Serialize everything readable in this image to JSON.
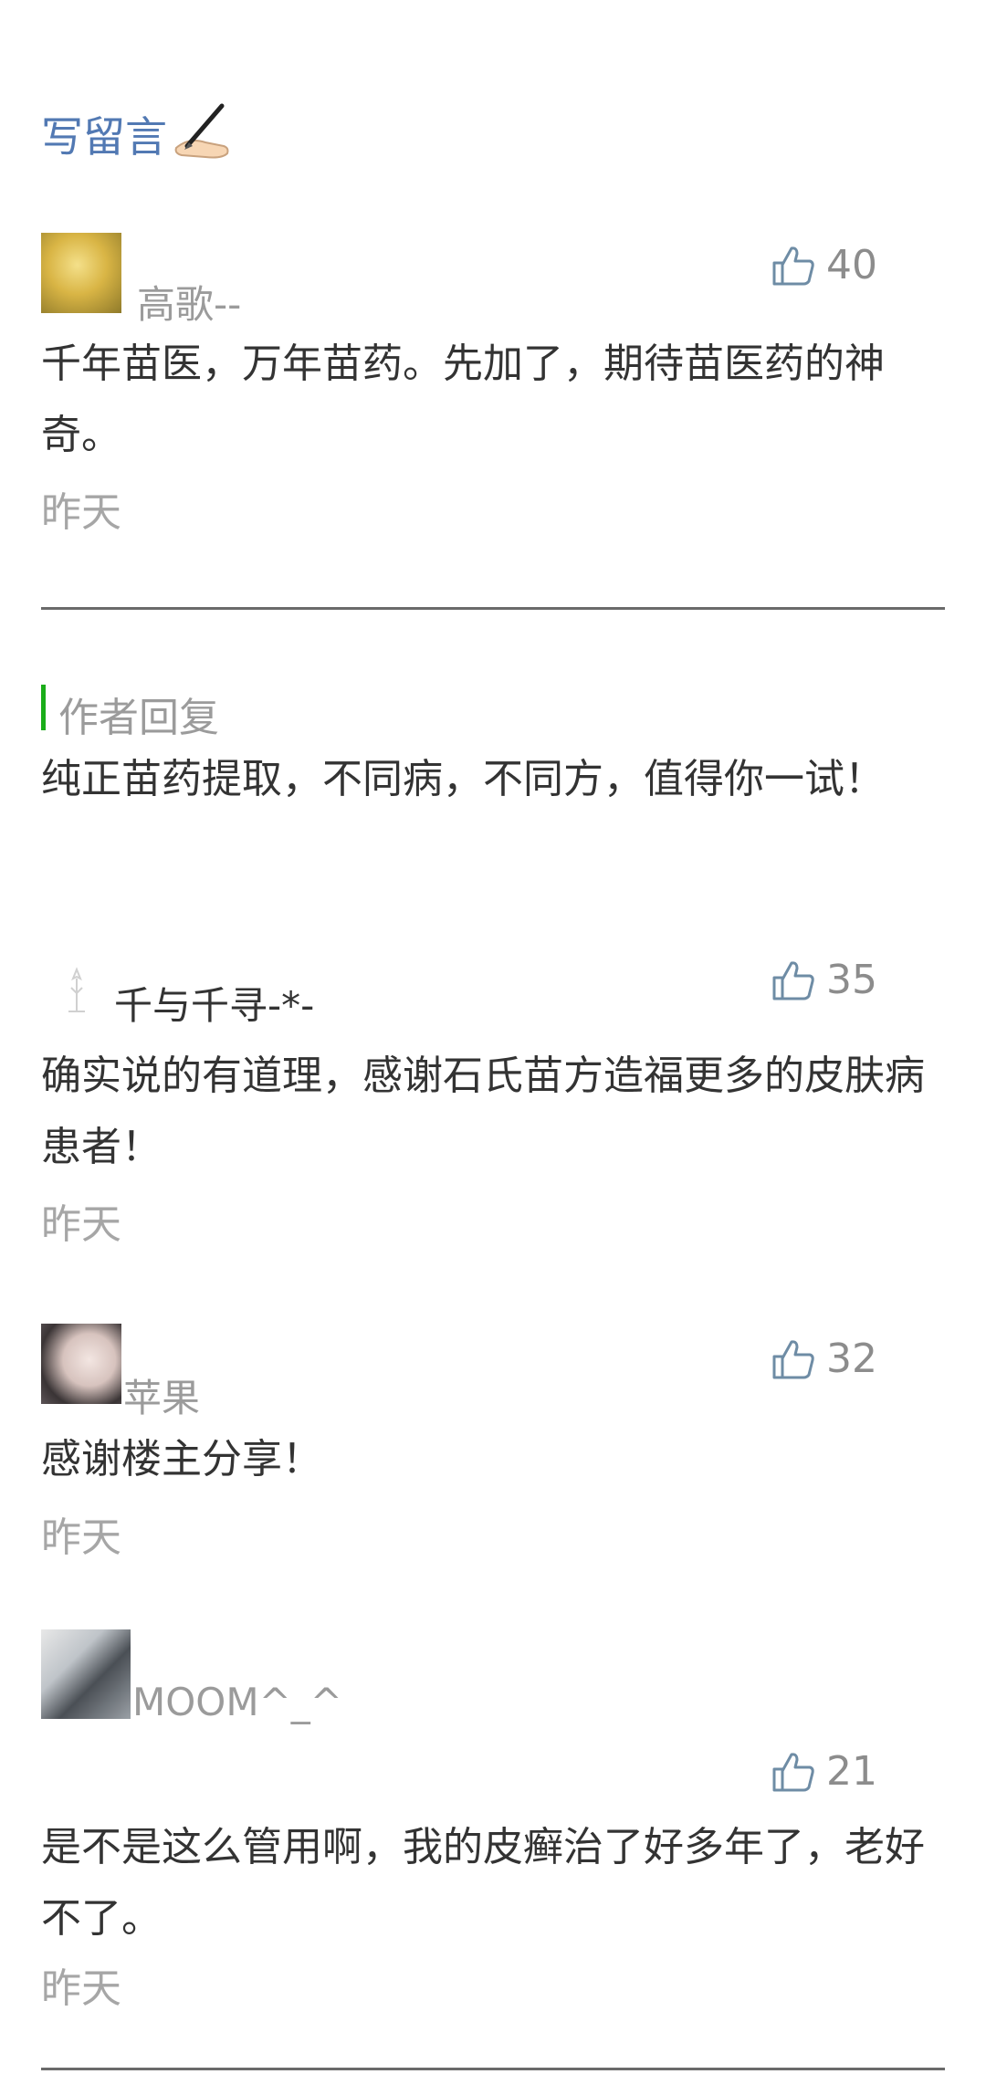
{
  "header": {
    "write_comment": "写留言"
  },
  "comments": [
    {
      "name": "高歌--",
      "likes": "40",
      "content": "千年苗医，万年苗药。先加了，期待苗医药的神奇。",
      "time": "昨天"
    },
    {
      "name": "千与千寻-*-",
      "likes": "35",
      "content": "确实说的有道理，感谢石氏苗方造福更多的皮肤病患者！",
      "time": "昨天"
    },
    {
      "name": "苹果",
      "likes": "32",
      "content": "感谢楼主分享！",
      "time": "昨天"
    },
    {
      "name": "MOOM^_^",
      "likes": "21",
      "content": "是不是这么管用啊，我的皮癣治了好多年了，老好不了。",
      "time": "昨天"
    }
  ],
  "author_reply": {
    "label": "作者回复",
    "content": "纯正苗药提取，不同病，不同方，值得你一试！"
  },
  "icons": {
    "like": "thumbs-up-icon",
    "write": "pen-hand-icon"
  },
  "colors": {
    "link": "#5279b3",
    "reply_bar": "#1aad19",
    "text": "#333333",
    "muted": "#9b9b9b"
  }
}
